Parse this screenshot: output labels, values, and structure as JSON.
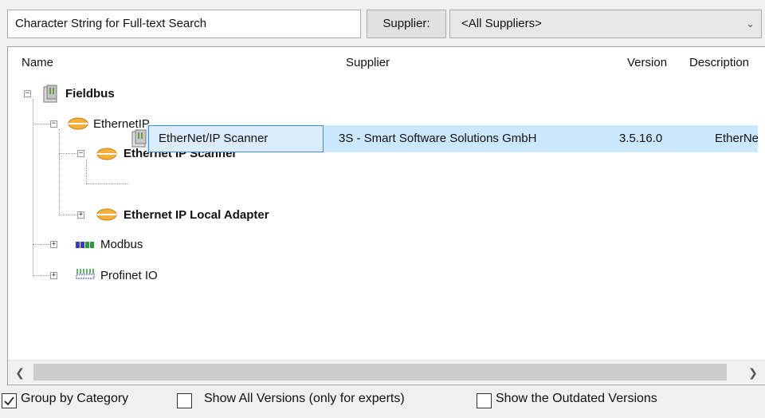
{
  "search": {
    "placeholder": "Character String for Full-text Search"
  },
  "supplier": {
    "label": "Supplier:",
    "selected": "<All Suppliers>"
  },
  "columns": {
    "name": "Name",
    "supplier": "Supplier",
    "version": "Version",
    "description": "Description"
  },
  "tree": {
    "fieldbus": "Fieldbus",
    "ethernetip": "EthernetIP",
    "ethernet_ip_scanner": "Ethernet IP Scanner",
    "selected_item": {
      "name": "EtherNet/IP Scanner",
      "supplier": "3S - Smart Software Solutions GmbH",
      "version": "3.5.16.0",
      "description": "EtherNe"
    },
    "ethernet_ip_local_adapter": "Ethernet IP Local Adapter",
    "modbus": "Modbus",
    "profinet": "Profinet IO"
  },
  "options": {
    "group_by_category": {
      "label": "Group by Category",
      "checked": true
    },
    "show_all_versions": {
      "label": "Show All Versions (only for experts)",
      "checked": false
    },
    "show_outdated": {
      "label": "Show the Outdated Versions",
      "checked": false
    }
  },
  "icons": {
    "folder": "device-folder-icon",
    "ethernet": "ethernet-ip-icon",
    "modbus": "modbus-icon",
    "profinet": "profinet-icon",
    "device": "device-module-icon"
  },
  "colors": {
    "selection": "#cce8ff",
    "selection_border": "#3f8ee6",
    "ethernet_icon": "#f0a020"
  }
}
